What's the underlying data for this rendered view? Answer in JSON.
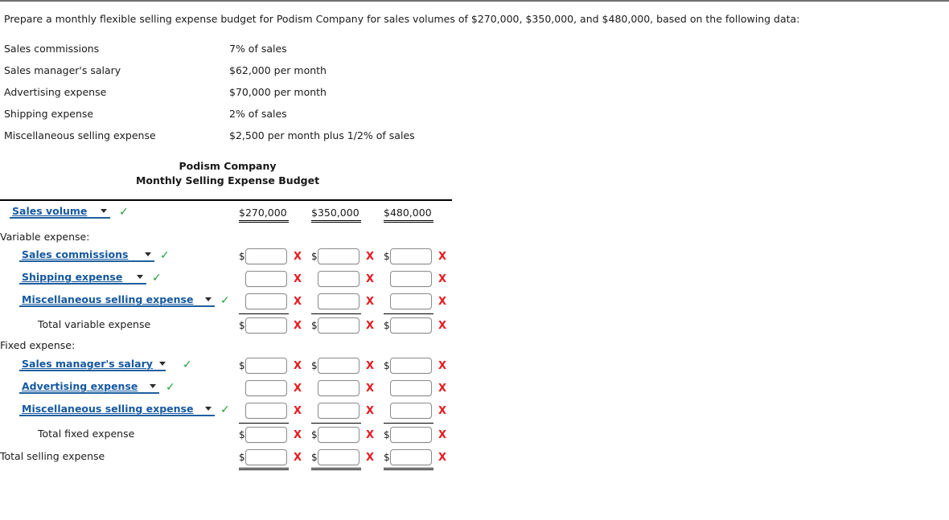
{
  "prompt": "Prepare a monthly flexible selling expense budget for Podism Company for sales volumes of $270,000, $350,000, and $480,000, based on the following data:",
  "given_data": [
    {
      "label": "Sales commissions",
      "value": "7% of sales"
    },
    {
      "label": "Sales manager's salary",
      "value": "$62,000 per month"
    },
    {
      "label": "Advertising expense",
      "value": "$70,000 per month"
    },
    {
      "label": "Shipping expense",
      "value": "2% of sales"
    },
    {
      "label": "Miscellaneous selling expense",
      "value": "$2,500 per month plus 1/2% of sales"
    }
  ],
  "statement": {
    "company": "Podism Company",
    "title": "Monthly Selling Expense Budget",
    "columns": [
      "$270,000",
      "$350,000",
      "$480,000"
    ],
    "sales_volume_label": "Sales volume",
    "section_variable": "Variable expense:",
    "section_fixed": "Fixed expense:",
    "variable_rows": [
      {
        "label": "Sales commissions",
        "type": "dropdown",
        "status": "correct"
      },
      {
        "label": "Shipping expense",
        "type": "dropdown",
        "status": "correct"
      },
      {
        "label": "Miscellaneous selling expense",
        "type": "dropdown",
        "status": "correct"
      }
    ],
    "total_variable_label": "Total variable expense",
    "fixed_rows": [
      {
        "label": "Sales manager's salary",
        "type": "dropdown",
        "status": "correct"
      },
      {
        "label": "Advertising expense",
        "type": "dropdown",
        "status": "correct"
      },
      {
        "label": "Miscellaneous selling expense",
        "type": "dropdown",
        "status": "correct"
      }
    ],
    "total_fixed_label": "Total fixed expense",
    "total_selling_label": "Total selling expense",
    "currency_symbol": "$",
    "input_values": [
      "",
      "",
      ""
    ],
    "input_placeholder": "",
    "correct_mark": "✓",
    "incorrect_mark": "X"
  },
  "colors": {
    "dropdown_text": "#1558a0",
    "dropdown_underline": "#1f5f9e",
    "correct_green": "#1ea03c",
    "incorrect_red": "#e8191e",
    "rule_black": "#000000"
  }
}
